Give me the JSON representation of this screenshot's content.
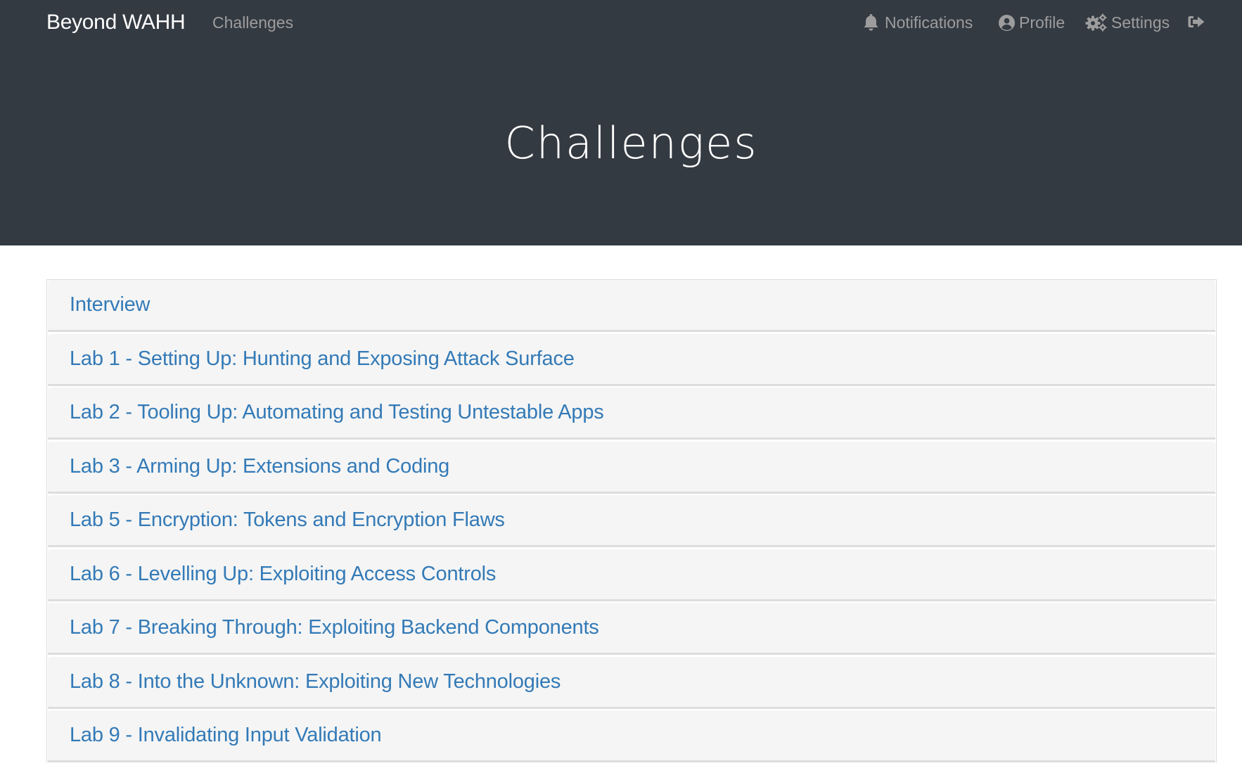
{
  "navbar": {
    "brand": "Beyond WAHH",
    "links": [
      {
        "label": "Challenges",
        "icon": null
      },
      {
        "label": "Notifications",
        "icon": "bell-icon"
      },
      {
        "label": "Profile",
        "icon": "user-circle-icon"
      },
      {
        "label": "Settings",
        "icon": "gears-icon"
      },
      {
        "label": "",
        "icon": "sign-out-icon"
      }
    ]
  },
  "page": {
    "title": "Challenges"
  },
  "challenges": [
    {
      "label": "Interview"
    },
    {
      "label": "Lab 1 - Setting Up: Hunting and Exposing Attack Surface"
    },
    {
      "label": "Lab 2 - Tooling Up: Automating and Testing Untestable Apps"
    },
    {
      "label": "Lab 3 - Arming Up: Extensions and Coding"
    },
    {
      "label": "Lab 5 - Encryption: Tokens and Encryption Flaws"
    },
    {
      "label": "Lab 6 - Levelling Up: Exploiting Access Controls"
    },
    {
      "label": "Lab 7 - Breaking Through: Exploiting Backend Components"
    },
    {
      "label": "Lab 8 - Into the Unknown: Exploiting New Technologies"
    },
    {
      "label": "Lab 9 - Invalidating Input Validation"
    }
  ],
  "colors": {
    "header_bg": "#343a42",
    "nav_text": "#9d9d9d",
    "link": "#337ab7",
    "panel_bg": "#f5f5f5",
    "panel_border": "#dddddd"
  }
}
